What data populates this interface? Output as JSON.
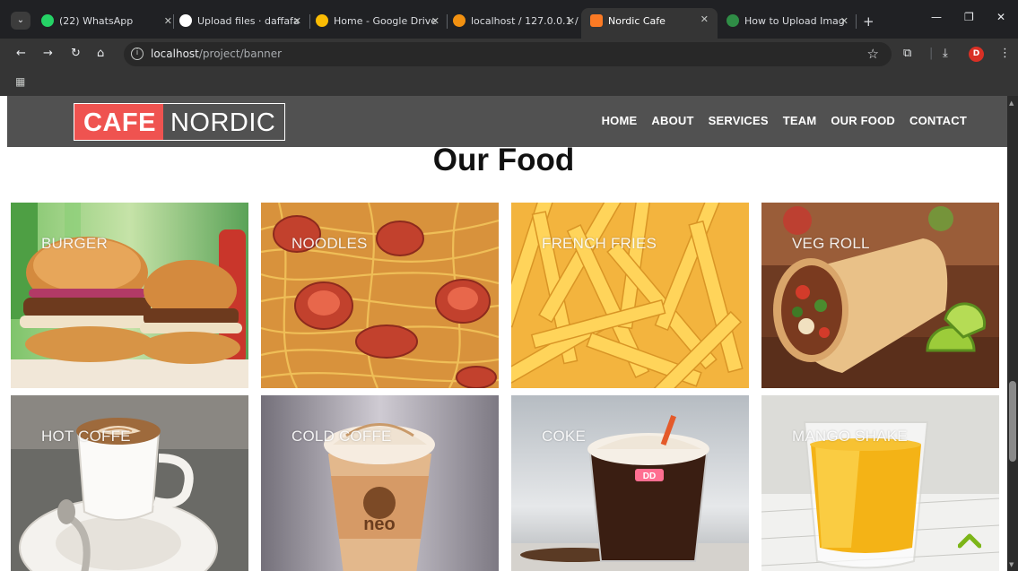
{
  "browser": {
    "tabs": [
      {
        "label": "(22) WhatsApp",
        "icon": "whatsapp-icon",
        "color": "#25d366"
      },
      {
        "label": "Upload files · daffafa",
        "icon": "github-icon",
        "color": "#ffffff"
      },
      {
        "label": "Home - Google Drive",
        "icon": "google-drive-icon",
        "color": "#fbbc04"
      },
      {
        "label": "localhost / 127.0.0.1 /",
        "icon": "phpmyadmin-icon",
        "color": "#f29111"
      },
      {
        "label": "Nordic Cafe",
        "icon": "xampp-icon",
        "color": "#fb7a24"
      },
      {
        "label": "How to Upload Imag",
        "icon": "gfg-icon",
        "color": "#2f8d46"
      }
    ],
    "new_tab": "+",
    "url_host": "localhost",
    "url_path": "/project/banner",
    "avatar_initial": "D"
  },
  "site": {
    "logo_part1": "CAFE",
    "logo_part2": "NORDIC",
    "nav": [
      "HOME",
      "ABOUT",
      "SERVICES",
      "TEAM",
      "OUR FOOD",
      "CONTACT"
    ],
    "section_title": "Our Food",
    "foods": [
      {
        "name": "BURGER",
        "image": "burger"
      },
      {
        "name": "NOODLES",
        "image": "noodles"
      },
      {
        "name": "FRENCH FRIES",
        "image": "fries"
      },
      {
        "name": "VEG ROLL",
        "image": "roll"
      },
      {
        "name": "HOT COFFE",
        "image": "hot-coffee"
      },
      {
        "name": "COLD COFFE",
        "image": "cold-coffee"
      },
      {
        "name": "COKE",
        "image": "coke"
      },
      {
        "name": "MANGO SHAKE",
        "image": "mango-shake"
      }
    ],
    "cup_brand": "neo",
    "coke_badge": "DD"
  },
  "colors": {
    "header_bg": "#515151",
    "logo_red": "#ef5350",
    "to_top_green": "#7cb518"
  }
}
